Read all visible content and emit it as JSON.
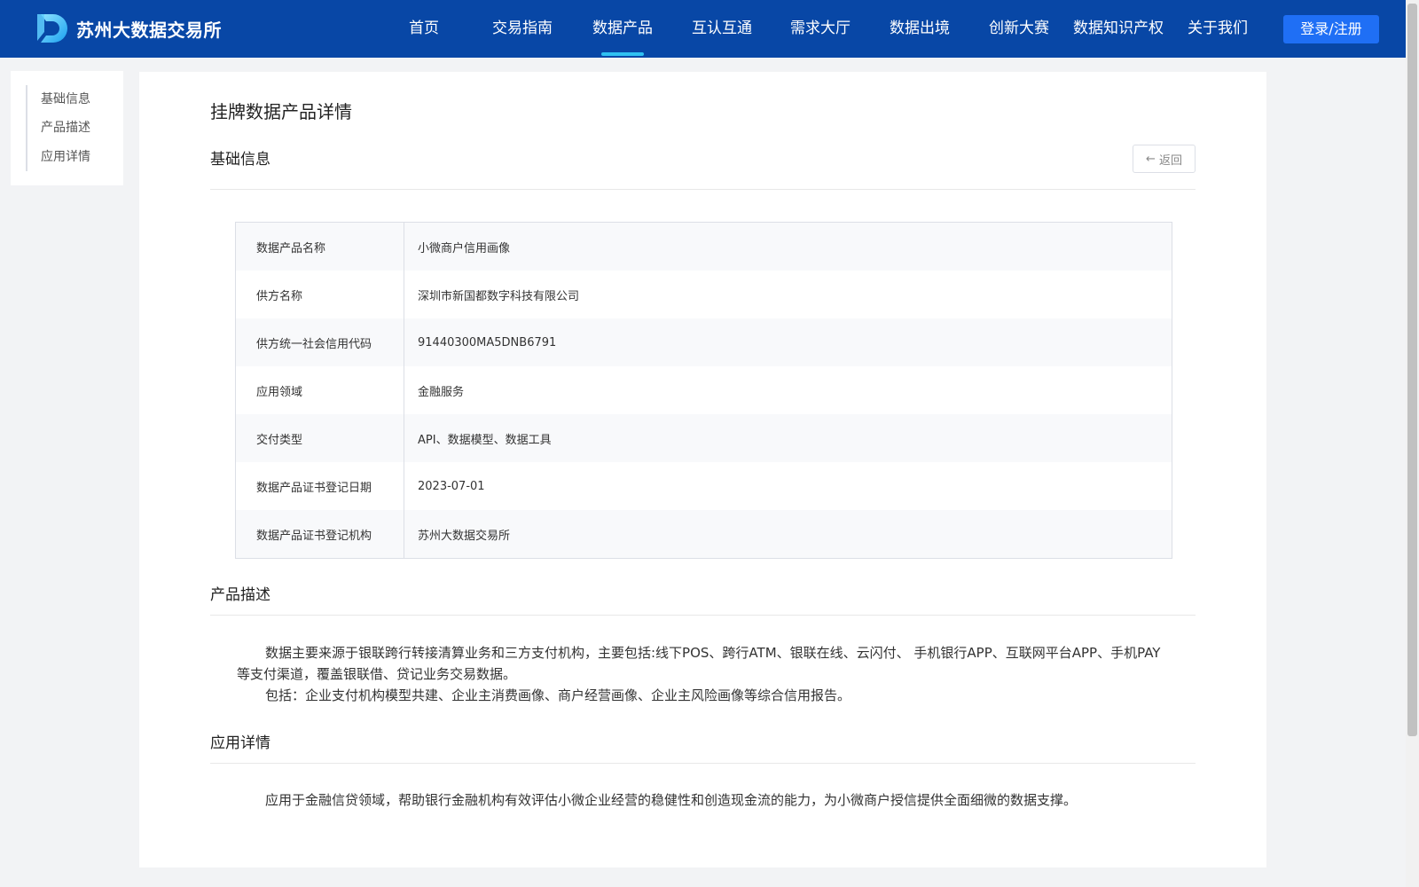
{
  "header": {
    "site_name": "苏州大数据交易所",
    "nav": [
      {
        "label": "首页",
        "active": false
      },
      {
        "label": "交易指南",
        "active": false
      },
      {
        "label": "数据产品",
        "active": true
      },
      {
        "label": "互认互通",
        "active": false
      },
      {
        "label": "需求大厅",
        "active": false
      },
      {
        "label": "数据出境",
        "active": false
      },
      {
        "label": "创新大赛",
        "active": false
      },
      {
        "label": "数据知识产权",
        "active": false
      },
      {
        "label": "关于我们",
        "active": false
      }
    ],
    "login_label": "登录/注册",
    "colors": {
      "background": "#0847a6",
      "active_underline": "#2fc1f2",
      "login_button": "#1f6ff5"
    }
  },
  "sidenav": {
    "items": [
      {
        "label": "基础信息"
      },
      {
        "label": "产品描述"
      },
      {
        "label": "应用详情"
      }
    ]
  },
  "main": {
    "page_title": "挂牌数据产品详情",
    "basic_info": {
      "title": "基础信息",
      "back_label": "返回",
      "back_icon": "arrow-left-icon",
      "rows": [
        {
          "label": "数据产品名称",
          "value": "小微商户信用画像"
        },
        {
          "label": "供方名称",
          "value": "深圳市新国都数字科技有限公司"
        },
        {
          "label": "供方统一社会信用代码",
          "value": "91440300MA5DNB6791"
        },
        {
          "label": "应用领域",
          "value": "金融服务"
        },
        {
          "label": "交付类型",
          "value": "API、数据模型、数据工具"
        },
        {
          "label": "数据产品证书登记日期",
          "value": "2023-07-01"
        },
        {
          "label": "数据产品证书登记机构",
          "value": "苏州大数据交易所"
        }
      ]
    },
    "description": {
      "title": "产品描述",
      "paragraphs": [
        "数据主要来源于银联跨行转接清算业务和三方支付机构，主要包括:线下POS、跨行ATM、银联在线、云闪付、 手机银行APP、互联网平台APP、手机PAY等支付渠道，覆盖银联借、贷记业务交易数据。",
        "包括：企业支付机构模型共建、企业主消费画像、商户经营画像、企业主风险画像等综合信用报告。"
      ]
    },
    "application": {
      "title": "应用详情",
      "paragraphs": [
        "应用于金融信贷领域，帮助银行金融机构有效评估小微企业经营的稳健性和创造现金流的能力，为小微商户授信提供全面细微的数据支撑。"
      ]
    }
  }
}
